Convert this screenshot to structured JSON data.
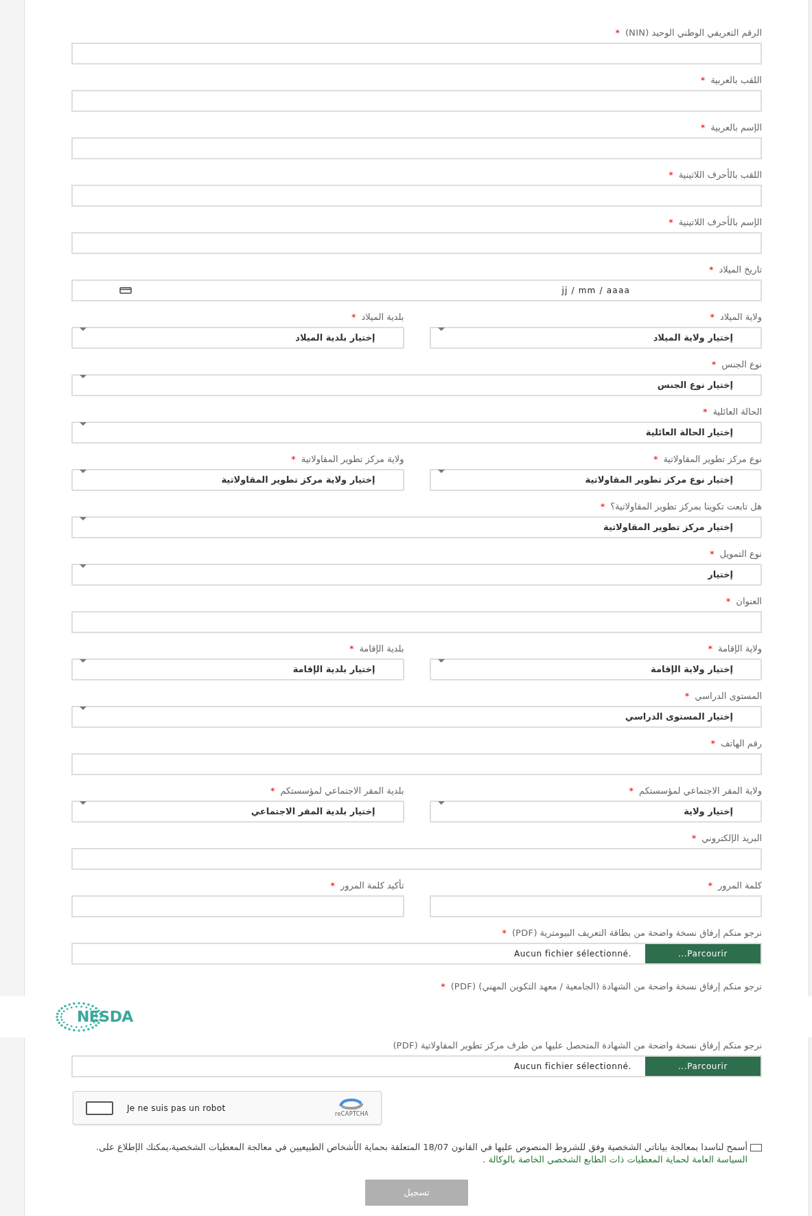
{
  "required_mark": "*",
  "sections": [
    {
      "kind": "form",
      "rows": [
        {
          "fields": [
            {
              "kind": "text",
              "label": "الرقم التعريفي الوطني الوحيد (NIN)",
              "required": true
            }
          ]
        },
        {
          "fields": [
            {
              "kind": "text",
              "label": "اللقب بالعربية",
              "required": true
            }
          ]
        },
        {
          "fields": [
            {
              "kind": "text",
              "label": "الإسم بالعربية",
              "required": true
            }
          ]
        },
        {
          "fields": [
            {
              "kind": "text",
              "label": "اللقب بالأحرف اللاتينية",
              "required": true
            }
          ]
        },
        {
          "fields": [
            {
              "kind": "text",
              "label": "الإسم بالأحرف اللاتينية",
              "required": true
            }
          ]
        },
        {
          "fields": [
            {
              "kind": "date",
              "label": "تاريخ الميلاد",
              "required": true,
              "placeholder": "jj / mm / aaaa"
            }
          ]
        },
        {
          "fields": [
            {
              "kind": "select",
              "label": "ولاية الميلاد",
              "required": true,
              "value": "إختيار ولاية الميلاد"
            },
            {
              "kind": "select",
              "label": "بلدية الميلاد",
              "required": true,
              "value": "إختيار بلدية الميلاد"
            }
          ]
        },
        {
          "fields": [
            {
              "kind": "select",
              "label": "نوع الجنس",
              "required": true,
              "value": "إختيار نوع الجنس"
            }
          ]
        },
        {
          "fields": [
            {
              "kind": "select",
              "label": "الحالة العائلية",
              "required": true,
              "value": "إختيار الحالة العائلية"
            }
          ]
        },
        {
          "fields": [
            {
              "kind": "select",
              "label": "نوع مركز تطوير المقاولاتية",
              "required": true,
              "value": "إختيار نوع مركز تطوير المقاولاتية"
            },
            {
              "kind": "select",
              "label": "ولاية مركز تطوير المقاولاتية",
              "required": true,
              "value": "إختيار ولاية مركز تطوير المقاولاتية"
            }
          ]
        },
        {
          "fields": [
            {
              "kind": "select",
              "label": "هل تابعت تكوينا بمركز تطوير المقاولاتية؟",
              "required": true,
              "value": "إختيار مركز تطوير المقاولاتية"
            }
          ]
        },
        {
          "fields": [
            {
              "kind": "select",
              "label": "نوع التمويل",
              "required": true,
              "value": "إختيار"
            }
          ]
        },
        {
          "fields": [
            {
              "kind": "text",
              "label": "العنوان",
              "required": true
            }
          ]
        },
        {
          "fields": [
            {
              "kind": "select",
              "label": "ولاية الإقامة",
              "required": true,
              "value": "إختيار ولاية الإقامة"
            },
            {
              "kind": "select",
              "label": "بلدية الإقامة",
              "required": true,
              "value": "إختيار بلدية الإقامة"
            }
          ]
        },
        {
          "fields": [
            {
              "kind": "select",
              "label": "المستوى الدراسي",
              "required": true,
              "value": "إختيار المستوى الدراسي"
            }
          ]
        },
        {
          "fields": [
            {
              "kind": "text",
              "label": "رقم الهاتف",
              "required": true
            }
          ]
        },
        {
          "fields": [
            {
              "kind": "select",
              "label": "ولاية المقر الاجتماعي لمؤسستكم",
              "required": true,
              "value": "إختيار ولاية"
            },
            {
              "kind": "select",
              "label": "بلدية المقر الاجتماعي لمؤسستكم",
              "required": true,
              "value": "إختيار بلدية المقر الاجتماعي"
            }
          ]
        },
        {
          "fields": [
            {
              "kind": "text",
              "label": "البريد الإلكتروني",
              "required": true
            }
          ]
        },
        {
          "fields": [
            {
              "kind": "text",
              "label": "كلمة المرور",
              "required": true
            },
            {
              "kind": "text",
              "label": "تأكيد كلمة المرور",
              "required": true
            }
          ]
        },
        {
          "fields": [
            {
              "kind": "file",
              "label": "نرجو منكم إرفاق نسخة واضحة من بطاقة التعريف البيومترية (PDF)",
              "required": true,
              "button": "Parcourir...",
              "status": "Aucun fichier sélectionné."
            }
          ]
        },
        {
          "fields": [
            {
              "kind": "file",
              "label": "نرجو منكم إرفاق نسخة واضحة من الشهادة (الجامعية / معهد التكوين المهني) (PDF)",
              "required": true
            }
          ]
        }
      ]
    },
    {
      "kind": "banner",
      "logo_text": "NESDA"
    },
    {
      "kind": "form",
      "rows": [
        {
          "fields": [
            {
              "kind": "file",
              "label": "نرجو منكم إرفاق نسخة واضحة من الشهادة المتحصل عليها من طرف مركز تطوير المقاولاتية (PDF)",
              "required": false,
              "button": "Parcourir...",
              "status": "Aucun fichier sélectionné."
            }
          ]
        }
      ]
    }
  ],
  "captcha": {
    "checked": false,
    "label": "Je ne suis pas un robot",
    "brand": "reCAPTCHA"
  },
  "consent": {
    "checked": false,
    "text": "أسمح لناسدا بمعالجة بياناتي الشخصية وفق للشروط المنصوص عليها في القانون 18/07 المتعلقة بحماية الأشخاص الطبيعيين في معالجة المعطيات الشخصية،يمكنك الإطلاع على.",
    "link": "السياسة العامة لحماية المعطيات ذات الطابع الشخصي الخاصة بالوكالة",
    "end": "."
  },
  "submit": {
    "label": "تسجيل",
    "disabled": true
  }
}
